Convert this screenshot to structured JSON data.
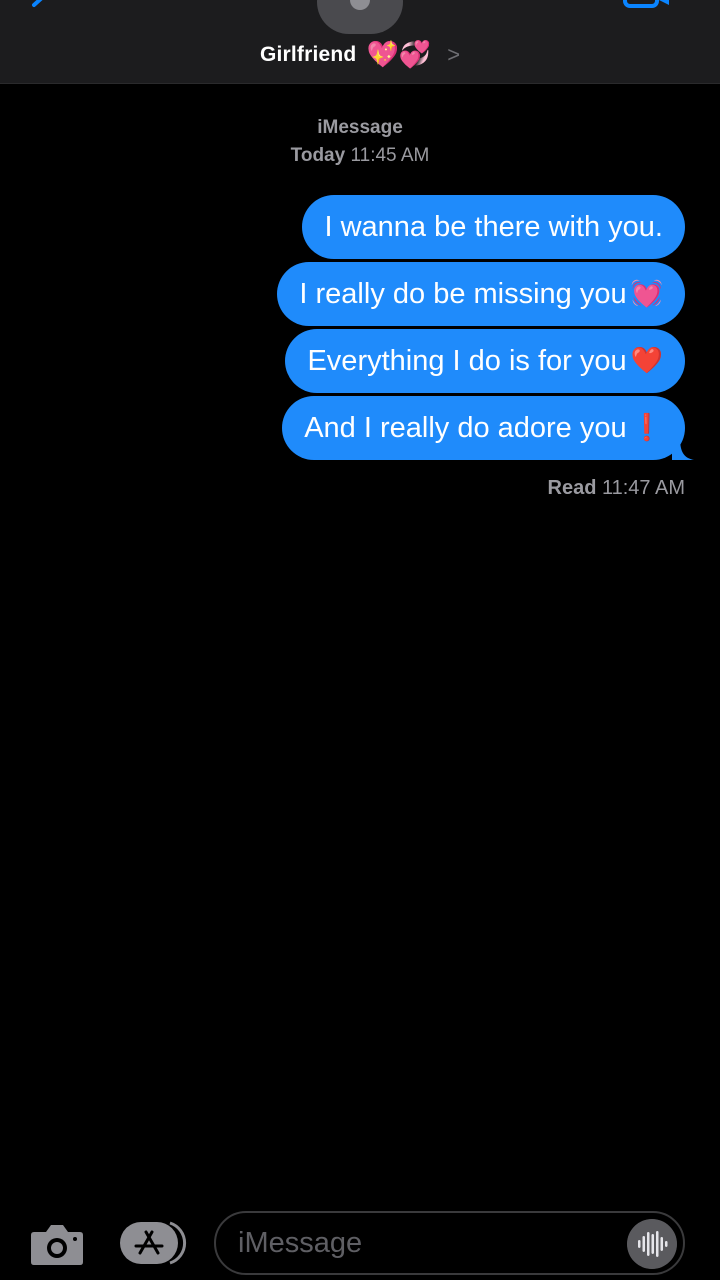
{
  "header": {
    "contact_name": "Girlfriend",
    "contact_emojis": "💖💞",
    "chevron": ">"
  },
  "meta": {
    "service": "iMessage",
    "day": "Today",
    "time": "11:45 AM"
  },
  "messages": [
    {
      "text": "I wanna be there with you.",
      "emoji": ""
    },
    {
      "text": "I really do be missing you",
      "emoji": "💓"
    },
    {
      "text": "Everything I do is for you",
      "emoji": "❤️"
    },
    {
      "text": "And I really do adore you",
      "emoji": "❗"
    }
  ],
  "read_receipt": {
    "label": "Read",
    "time": "11:47 AM"
  },
  "composer": {
    "placeholder": "iMessage"
  },
  "icons": {
    "back": "back-chevron-icon",
    "video": "video-camera-icon",
    "camera": "camera-icon",
    "apps": "app-store-icon",
    "audio": "audio-waveform-icon"
  },
  "colors": {
    "bubble": "#1f8bfb",
    "header": "#1c1c1e",
    "background": "#000000",
    "meta_text": "#9a9aa0",
    "accent": "#0a84ff"
  }
}
